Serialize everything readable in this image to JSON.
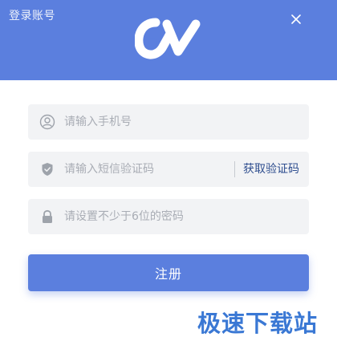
{
  "window": {
    "title": "登录账号"
  },
  "colors": {
    "brand": "#5b7fde",
    "field_bg": "#f2f3f5",
    "link": "#2f4e8f",
    "watermark": "#3a78d4"
  },
  "form": {
    "phone": {
      "placeholder": "请输入手机号",
      "icon": "user-icon"
    },
    "sms_code": {
      "placeholder": "请输入短信验证码",
      "icon": "shield-icon",
      "get_code_label": "获取验证码"
    },
    "password": {
      "placeholder": "请设置不少于6位的密码",
      "icon": "lock-icon"
    },
    "submit_label": "注册"
  },
  "watermark": "极速下载站"
}
